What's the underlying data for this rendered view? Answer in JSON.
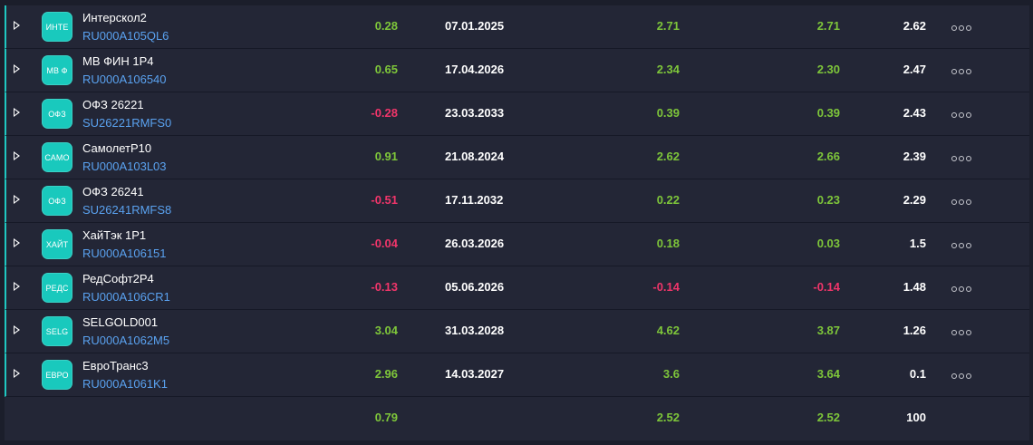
{
  "rows": [
    {
      "logo": "ИНТЕ",
      "name": "Интерскол2",
      "isin": "RU000A105QL6",
      "change": "0.28",
      "change_sign": "pos",
      "date": "07.01.2025",
      "v3": "2.71",
      "v3_sign": "pos",
      "v4": "2.71",
      "v4_sign": "pos",
      "weight": "2.62"
    },
    {
      "logo": "МВ Ф",
      "name": "МВ ФИН 1Р4",
      "isin": "RU000A106540",
      "change": "0.65",
      "change_sign": "pos",
      "date": "17.04.2026",
      "v3": "2.34",
      "v3_sign": "pos",
      "v4": "2.30",
      "v4_sign": "pos",
      "weight": "2.47"
    },
    {
      "logo": "ОФЗ",
      "name": "ОФЗ 26221",
      "isin": "SU26221RMFS0",
      "change": "-0.28",
      "change_sign": "neg",
      "date": "23.03.2033",
      "v3": "0.39",
      "v3_sign": "pos",
      "v4": "0.39",
      "v4_sign": "pos",
      "weight": "2.43"
    },
    {
      "logo": "САМО",
      "name": "СамолетР10",
      "isin": "RU000A103L03",
      "change": "0.91",
      "change_sign": "pos",
      "date": "21.08.2024",
      "v3": "2.62",
      "v3_sign": "pos",
      "v4": "2.66",
      "v4_sign": "pos",
      "weight": "2.39"
    },
    {
      "logo": "ОФЗ",
      "name": "ОФЗ 26241",
      "isin": "SU26241RMFS8",
      "change": "-0.51",
      "change_sign": "neg",
      "date": "17.11.2032",
      "v3": "0.22",
      "v3_sign": "pos",
      "v4": "0.23",
      "v4_sign": "pos",
      "weight": "2.29"
    },
    {
      "logo": "ХАЙТ",
      "name": "ХайТэк 1Р1",
      "isin": "RU000A106151",
      "change": "-0.04",
      "change_sign": "neg",
      "date": "26.03.2026",
      "v3": "0.18",
      "v3_sign": "pos",
      "v4": "0.03",
      "v4_sign": "pos",
      "weight": "1.5"
    },
    {
      "logo": "РЕДС",
      "name": "РедСофт2Р4",
      "isin": "RU000A106CR1",
      "change": "-0.13",
      "change_sign": "neg",
      "date": "05.06.2026",
      "v3": "-0.14",
      "v3_sign": "neg",
      "v4": "-0.14",
      "v4_sign": "neg",
      "weight": "1.48"
    },
    {
      "logo": "SELG",
      "name": "SELGOLD001",
      "isin": "RU000A1062M5",
      "change": "3.04",
      "change_sign": "pos",
      "date": "31.03.2028",
      "v3": "4.62",
      "v3_sign": "pos",
      "v4": "3.87",
      "v4_sign": "pos",
      "weight": "1.26"
    },
    {
      "logo": "ЕВРО",
      "name": "ЕвроТранс3",
      "isin": "RU000A1061K1",
      "change": "2.96",
      "change_sign": "pos",
      "date": "14.03.2027",
      "v3": "3.6",
      "v3_sign": "pos",
      "v4": "3.64",
      "v4_sign": "pos",
      "weight": "0.1"
    }
  ],
  "totals": {
    "change": "0.79",
    "v3": "2.52",
    "v4": "2.52",
    "weight": "100"
  },
  "colors": {
    "positive": "#7ec63a",
    "negative": "#f0356a",
    "accent": "#1fc7c1",
    "isin": "#5aa2f0"
  },
  "icons": {
    "expander": "triangle-right-icon",
    "more": "more-dots-icon"
  }
}
